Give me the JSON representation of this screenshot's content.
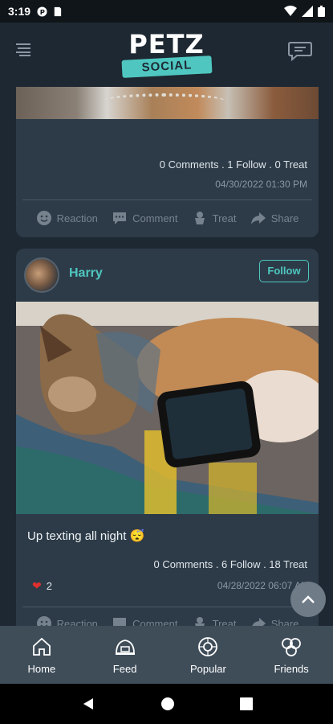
{
  "status_bar": {
    "time": "3:19"
  },
  "header": {
    "logo_top": "PETZ",
    "logo_bottom": "SOCIAL",
    "menu_icon": "menu-icon",
    "chat_icon": "chat-icon"
  },
  "posts": [
    {
      "stats": "0 Comments . 1 Follow . 0 Treat",
      "date": "04/30/2022 01:30 PM",
      "actions": [
        "Reaction",
        "Comment",
        "Treat",
        "Share"
      ]
    },
    {
      "username": "Harry",
      "follow_label": "Follow",
      "caption": "Up texting all night 😴",
      "stats": "0 Comments . 6 Follow . 18 Treat",
      "date": "04/28/2022 06:07 AM",
      "likes_count": "2",
      "actions": [
        "Reaction",
        "Comment",
        "Treat",
        "Share"
      ]
    }
  ],
  "bottom_nav": [
    {
      "label": "Home",
      "icon": "home-icon"
    },
    {
      "label": "Feed",
      "icon": "feed-icon"
    },
    {
      "label": "Popular",
      "icon": "popular-icon"
    },
    {
      "label": "Friends",
      "icon": "friends-icon"
    }
  ],
  "colors": {
    "background": "#1e2832",
    "card": "#2d3b48",
    "accent": "#4fc7c0",
    "bottom_nav": "#3f4d59"
  }
}
